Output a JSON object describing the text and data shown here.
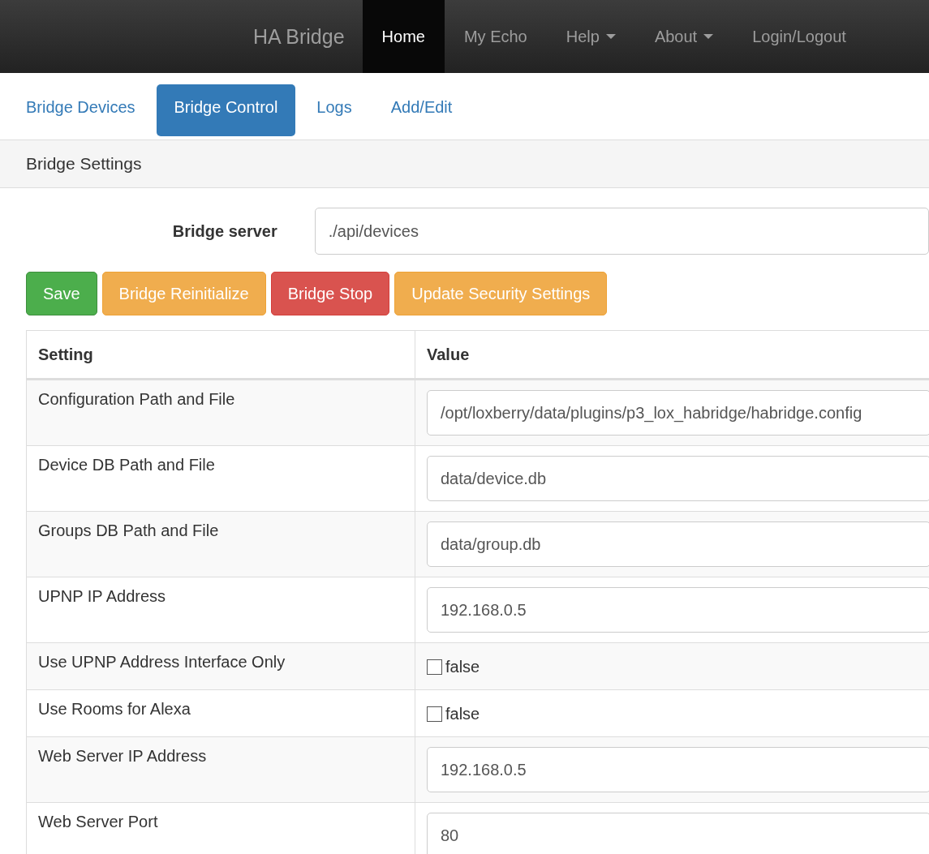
{
  "navbar": {
    "brand": "HA Bridge",
    "items": [
      {
        "label": "Home",
        "selected": true,
        "dropdown": false
      },
      {
        "label": "My Echo",
        "selected": false,
        "dropdown": false
      },
      {
        "label": "Help",
        "selected": false,
        "dropdown": true
      },
      {
        "label": "About",
        "selected": false,
        "dropdown": true
      },
      {
        "label": "Login/Logout",
        "selected": false,
        "dropdown": false
      }
    ]
  },
  "tabs": [
    {
      "label": "Bridge Devices",
      "selected": false
    },
    {
      "label": "Bridge Control",
      "selected": true
    },
    {
      "label": "Logs",
      "selected": false
    },
    {
      "label": "Add/Edit",
      "selected": false
    }
  ],
  "panel": {
    "title": "Bridge Settings",
    "server": {
      "label": "Bridge server",
      "value": "./api/devices"
    },
    "buttons": [
      {
        "label": "Save",
        "kind": "success"
      },
      {
        "label": "Bridge Reinitialize",
        "kind": "warning"
      },
      {
        "label": "Bridge Stop",
        "kind": "danger"
      },
      {
        "label": "Update Security Settings",
        "kind": "warning"
      }
    ],
    "table": {
      "columns": [
        "Setting",
        "Value"
      ],
      "rows": [
        {
          "setting": "Configuration Path and File",
          "kind": "text",
          "value": "/opt/loxberry/data/plugins/p3_lox_habridge/habridge.config"
        },
        {
          "setting": "Device DB Path and File",
          "kind": "text",
          "value": "data/device.db"
        },
        {
          "setting": "Groups DB Path and File",
          "kind": "text",
          "value": "data/group.db"
        },
        {
          "setting": "UPNP IP Address",
          "kind": "text",
          "value": "192.168.0.5"
        },
        {
          "setting": "Use UPNP Address Interface Only",
          "kind": "checkbox",
          "checked": false,
          "label": "false"
        },
        {
          "setting": "Use Rooms for Alexa",
          "kind": "checkbox",
          "checked": false,
          "label": "false"
        },
        {
          "setting": "Web Server IP Address",
          "kind": "text",
          "value": "192.168.0.5"
        },
        {
          "setting": "Web Server Port",
          "kind": "text",
          "value": "80"
        }
      ]
    }
  }
}
